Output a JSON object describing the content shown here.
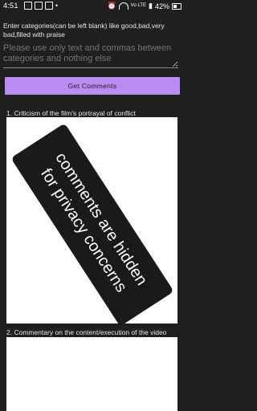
{
  "status_bar": {
    "time": "4:51",
    "battery": "42%",
    "network_label": "Vo LTE"
  },
  "form": {
    "categories_label": "Enter categories(can be left blank) like good,bad,very bad,filled with praise",
    "categories_placeholder": "Please use only text and commas between categories and nothing else",
    "get_comments_label": "Get Comments"
  },
  "sections": [
    {
      "title": "1. Criticism of the film's portrayal of conflict"
    },
    {
      "title": "2. Commentary on the content/execution of the video"
    }
  ],
  "overlay": {
    "line1": "comments are hidden",
    "line2": "for privacy concerns"
  },
  "colors": {
    "background": "#1f1f1f",
    "accent": "#b98cf0",
    "panel": "#ffffff",
    "overlay": "#1a1a1a"
  },
  "icons": [
    "message-icon",
    "mail-icon",
    "instagram-icon",
    "dot-icon",
    "alarm-icon",
    "wifi-icon",
    "signal-icon",
    "battery-icon"
  ]
}
